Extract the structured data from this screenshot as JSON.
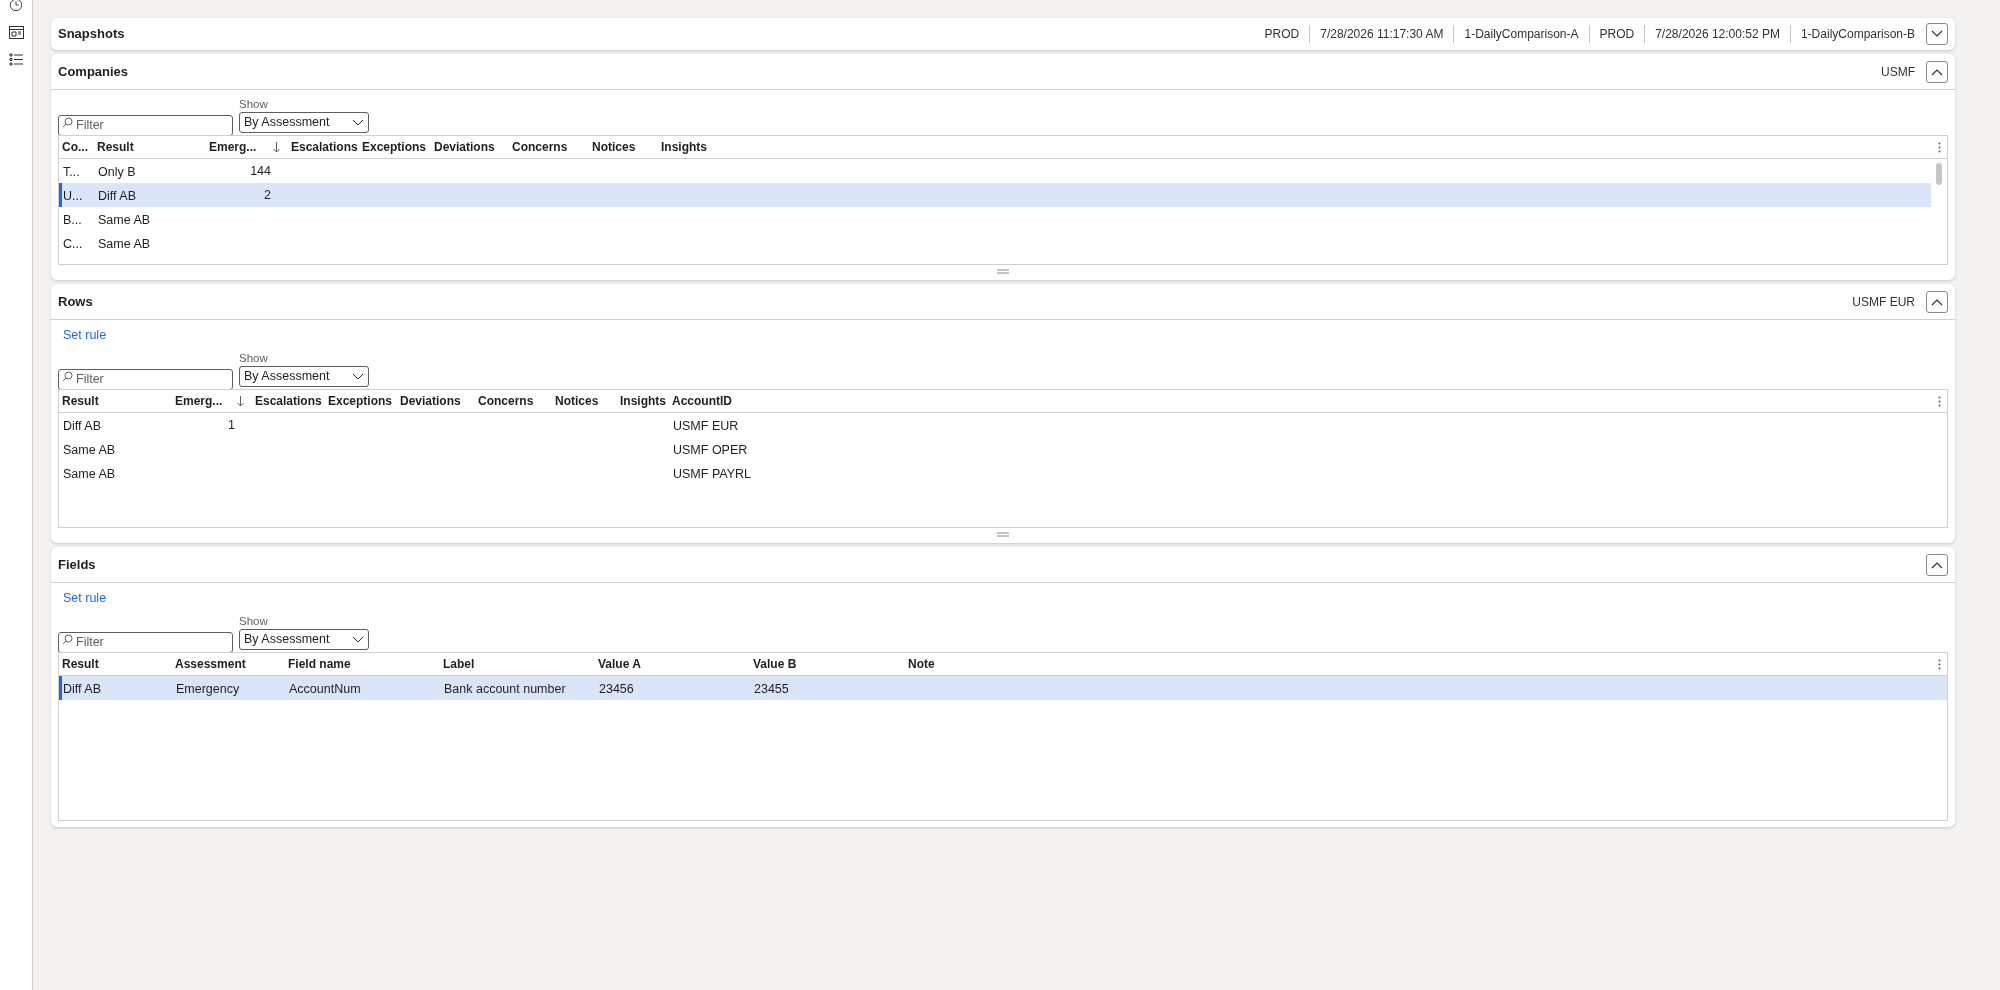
{
  "snapshots": {
    "title": "Snapshots",
    "info": [
      "PROD",
      "7/28/2026 11:17:30 AM",
      "1-DailyComparison-A",
      "PROD",
      "7/28/2026 12:00:52 PM",
      "1-DailyComparison-B"
    ],
    "expanded": false
  },
  "sections": [
    {
      "title": "Companies",
      "info": "USMF",
      "expanded": true,
      "show_label": "Show",
      "show_value": "By Assessment",
      "filter_placeholder": "Filter",
      "columns": [
        {
          "label": "Co...",
          "sorted": false
        },
        {
          "label": "Result",
          "sorted": false
        },
        {
          "label": "Emerg...",
          "sorted": true
        },
        {
          "label": "Escalations",
          "sorted": false
        },
        {
          "label": "Exceptions",
          "sorted": false
        },
        {
          "label": "Deviations",
          "sorted": false
        },
        {
          "label": "Concerns",
          "sorted": false
        },
        {
          "label": "Notices",
          "sorted": false
        },
        {
          "label": "Insights",
          "sorted": false
        }
      ],
      "rows": [
        {
          "selected": false,
          "cells": [
            "T...",
            "Only B",
            "144",
            null,
            null,
            null,
            null,
            null,
            null
          ]
        },
        {
          "selected": true,
          "cells": [
            "U...",
            "Diff AB",
            "2",
            null,
            null,
            null,
            null,
            null,
            null
          ]
        },
        {
          "selected": false,
          "cells": [
            "B...",
            "Same AB",
            null,
            null,
            null,
            null,
            null,
            null,
            null
          ]
        },
        {
          "selected": false,
          "cells": [
            "C...",
            "Same AB",
            null,
            null,
            null,
            null,
            null,
            null,
            null
          ]
        }
      ]
    },
    {
      "title": "Rows",
      "info": "USMF EUR",
      "expanded": true,
      "set_rule": "Set rule",
      "show_label": "Show",
      "show_value": "By Assessment",
      "filter_placeholder": "Filter",
      "columns": [
        {
          "label": "Result",
          "sorted": false
        },
        {
          "label": "Emerg...",
          "sorted": true
        },
        {
          "label": "Escalations",
          "sorted": false
        },
        {
          "label": "Exceptions",
          "sorted": false
        },
        {
          "label": "Deviations",
          "sorted": false
        },
        {
          "label": "Concerns",
          "sorted": false
        },
        {
          "label": "Notices",
          "sorted": false
        },
        {
          "label": "Insights",
          "sorted": false
        },
        {
          "label": "AccountID",
          "sorted": false
        }
      ],
      "rows": [
        {
          "selected": false,
          "cells": [
            "Diff AB",
            "1",
            null,
            null,
            null,
            null,
            null,
            null,
            "USMF EUR"
          ]
        },
        {
          "selected": false,
          "cells": [
            "Same AB",
            null,
            null,
            null,
            null,
            null,
            null,
            null,
            "USMF OPER"
          ]
        },
        {
          "selected": false,
          "cells": [
            "Same AB",
            null,
            null,
            null,
            null,
            null,
            null,
            null,
            "USMF PAYRL"
          ]
        }
      ]
    },
    {
      "title": "Fields",
      "expanded": true,
      "set_rule": "Set rule",
      "show_label": "Show",
      "show_value": "By Assessment",
      "filter_placeholder": "Filter",
      "columns": [
        {
          "label": "Result",
          "sorted": false
        },
        {
          "label": "Assessment",
          "sorted": false
        },
        {
          "label": "Field name",
          "sorted": false
        },
        {
          "label": "Label",
          "sorted": false
        },
        {
          "label": "Value A",
          "sorted": false
        },
        {
          "label": "Value B",
          "sorted": false
        },
        {
          "label": "Note",
          "sorted": false
        }
      ],
      "rows": [
        {
          "selected": true,
          "cells": [
            "Diff AB",
            "Emergency",
            "AccountNum",
            "Bank account number",
            "23456",
            "23455",
            null
          ]
        }
      ]
    }
  ]
}
